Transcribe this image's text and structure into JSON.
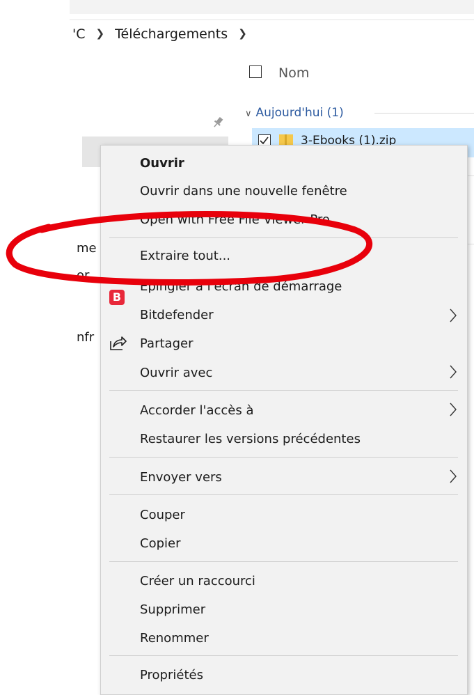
{
  "breadcrumb": {
    "parent": "'C",
    "current": "Téléchargements"
  },
  "columns": {
    "name": "Nom"
  },
  "group": {
    "label": "Aujourd'hui (1)"
  },
  "file": {
    "name": "3-Ebooks (1).zip"
  },
  "left_fragments": [
    "me",
    "or",
    "nfr"
  ],
  "menu": {
    "items": {
      "open": "Ouvrir",
      "open_new_window": "Ouvrir dans une nouvelle fenêtre",
      "open_with_viewer": "Open with Free File Viewer Pro",
      "extract_all": "Extraire tout...",
      "pin_start": "Épingler à l'écran de démarrage",
      "bitdefender": "Bitdefender",
      "share": "Partager",
      "open_with": "Ouvrir avec",
      "give_access": "Accorder l'accès à",
      "restore_versions": "Restaurer les versions précédentes",
      "send_to": "Envoyer vers",
      "cut": "Couper",
      "copy": "Copier",
      "create_shortcut": "Créer un raccourci",
      "delete": "Supprimer",
      "rename": "Renommer",
      "properties": "Propriétés"
    },
    "bitdefender_icon_letter": "B"
  },
  "colors": {
    "annotation": "#e8000b",
    "selection": "#cce8ff",
    "bitdefender": "#e8283a",
    "group_link": "#2c5aa0"
  },
  "icons": [
    "chevron-right-icon",
    "pin-icon",
    "checkbox-icon",
    "zip-folder-icon",
    "bitdefender-icon",
    "share-icon",
    "submenu-arrow-icon"
  ]
}
